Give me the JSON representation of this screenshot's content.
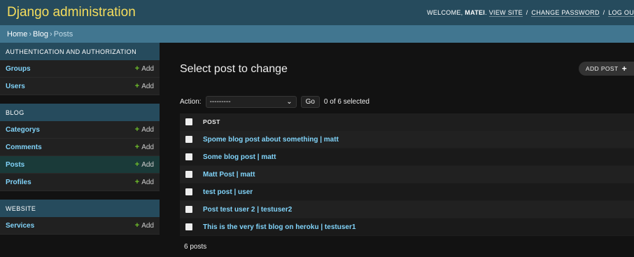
{
  "header": {
    "branding": "Django administration",
    "welcome": "Welcome,",
    "username": "matei",
    "view_site": "View site",
    "change_password": "Change password",
    "log_out": "Log ou"
  },
  "breadcrumbs": {
    "home": "Home",
    "app": "Blog",
    "current": "Posts",
    "separator": "›"
  },
  "sidebar": {
    "add_label": "Add",
    "modules": [
      {
        "caption": "Authentication and Authorization",
        "models": [
          {
            "name": "Groups",
            "current": false
          },
          {
            "name": "Users",
            "current": false
          }
        ]
      },
      {
        "caption": "Blog",
        "models": [
          {
            "name": "Categorys",
            "current": false
          },
          {
            "name": "Comments",
            "current": false
          },
          {
            "name": "Posts",
            "current": true
          },
          {
            "name": "Profiles",
            "current": false
          }
        ]
      },
      {
        "caption": "Website",
        "models": [
          {
            "name": "Services",
            "current": false
          }
        ]
      }
    ]
  },
  "content": {
    "title": "Select post to change",
    "add_button": "Add post",
    "actions": {
      "label": "Action:",
      "selected_option": "---------",
      "go": "Go",
      "counter": "0 of 6 selected"
    },
    "table": {
      "column_header": "Post",
      "rows": [
        "Spome blog post about something | matt",
        "Some blog post | matt",
        "Matt Post | matt",
        "test post | user",
        "Post test user 2 | testuser2",
        "This is the very fist blog on heroku | testuser1"
      ]
    },
    "paginator": "6 posts"
  },
  "colors": {
    "header_bg": "#264b5d",
    "branding": "#f5dd5d",
    "breadcrumbs_bg": "#417690",
    "link": "#81d4fa",
    "add_plus": "#70bf2b",
    "body_bg": "#121212",
    "current_model_bg": "#1a3a39"
  }
}
